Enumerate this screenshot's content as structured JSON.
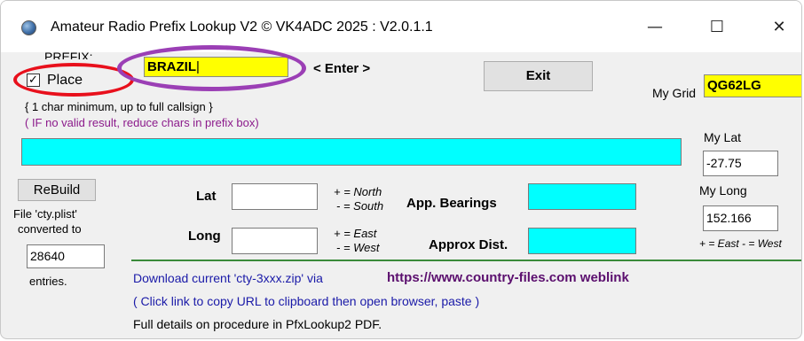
{
  "window": {
    "title": "Amateur Radio Prefix Lookup V2   © VK4ADC 2025 : V2.0.1.1",
    "minimize_glyph": "—",
    "maximize_glyph": "☐",
    "close_glyph": "✕"
  },
  "prefix": {
    "label": "PREFIX:",
    "value": "BRAZIL",
    "enter_hint": "< Enter >",
    "place_checkbox_label": "Place",
    "place_checked": true,
    "check_glyph": "✓",
    "hint_min": "{ 1 char minimum, up to full callsign }",
    "hint_no_result": "( IF no valid result, reduce chars in prefix box)"
  },
  "buttons": {
    "exit": "Exit",
    "rebuild": "ReBuild"
  },
  "my_station": {
    "grid_label": "My Grid",
    "grid_value": "QG62LG",
    "lat_label": "My Lat",
    "lat_value": "-27.75",
    "long_label": "My Long",
    "long_value": "152.166",
    "sign_hint": "+ = East - = West"
  },
  "result": {
    "text": ""
  },
  "file_info": {
    "line1": "File 'cty.plist'",
    "line2": "converted to",
    "count": "28640",
    "entries": "entries."
  },
  "target": {
    "lat_label": "Lat",
    "lat_value": "",
    "lat_hint_line1": "+ = North",
    "lat_hint_line2": "- = South",
    "long_label": "Long",
    "long_value": "",
    "long_hint_line1": "+ = East",
    "long_hint_line2": "- = West",
    "bearings_label": "App. Bearings",
    "bearings_value": "",
    "dist_label": "Approx Dist.",
    "dist_value": ""
  },
  "download": {
    "text": "Download current 'cty-3xxx.zip' via",
    "link": "https://www.country-files.com weblink",
    "clipboard_hint": "( Click link to copy URL to clipboard then open browser, paste )",
    "details": "Full details on procedure in PfxLookup2 PDF."
  },
  "colors": {
    "cyan": "#00ffff",
    "yellow": "#ffff00",
    "annotation_red": "#e8101c",
    "annotation_purple": "#9b3fb5",
    "link_purple": "#5b0f6e",
    "hint_purple": "#8b1a8b",
    "download_blue": "#1a1aa8",
    "divider_green": "#3a8a3a"
  }
}
